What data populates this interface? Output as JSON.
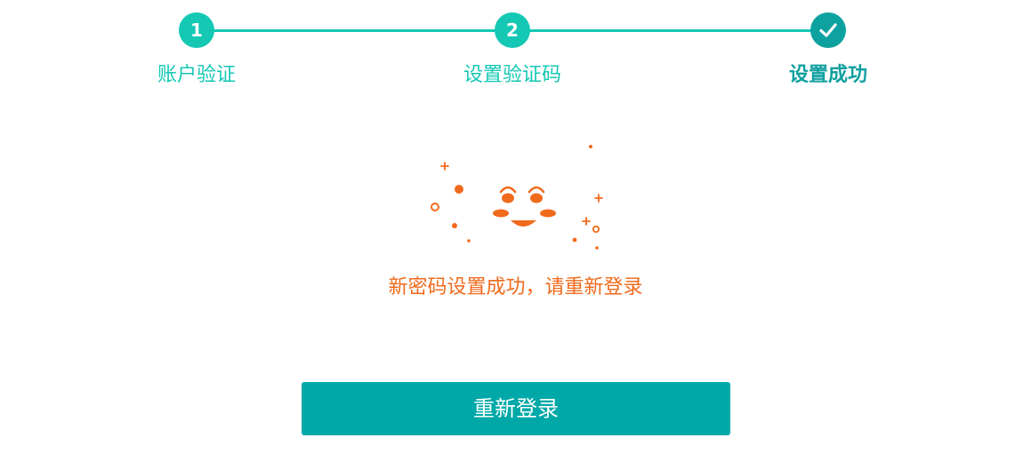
{
  "stepper": {
    "steps": [
      {
        "number": "1",
        "label": "账户验证",
        "state": "done"
      },
      {
        "number": "2",
        "label": "设置验证码",
        "state": "done"
      },
      {
        "number": "",
        "label": "设置成功",
        "state": "current",
        "icon": "check-icon"
      }
    ],
    "colors": {
      "done": "#14c8b4",
      "current": "#0da2a0"
    }
  },
  "result": {
    "message": "新密码设置成功，请重新登录",
    "illustration_icon": "smiley-face-icon",
    "accent_color": "#f06a1c"
  },
  "actions": {
    "relogin_label": "重新登录",
    "button_color": "#00a8a8"
  }
}
